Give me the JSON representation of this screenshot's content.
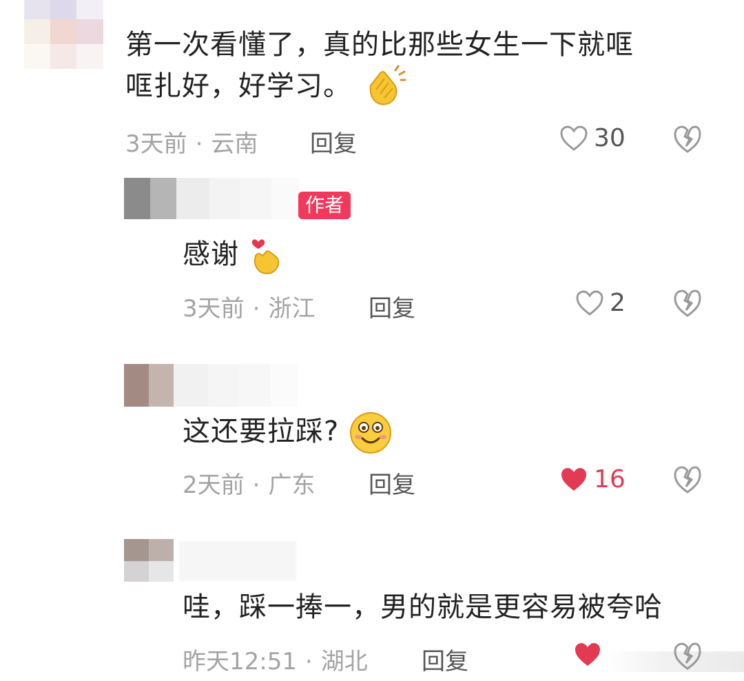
{
  "comments": [
    {
      "text_line1": "第一次看懂了，真的比那些女生一下就哐",
      "text_line2": "哐扎好，好学习。",
      "emoji": "clapping-hands",
      "time": "3天前",
      "location": "云南",
      "reply_label": "回复",
      "likes": "30",
      "liked": false
    },
    {
      "badge": "作者",
      "text": "感谢",
      "emoji": "finger-heart",
      "time": "3天前",
      "location": "浙江",
      "reply_label": "回复",
      "likes": "2",
      "liked": false
    },
    {
      "text": "这还要拉踩?",
      "emoji": "smiling-face",
      "time": "2天前",
      "location": "广东",
      "reply_label": "回复",
      "likes": "16",
      "liked": true
    },
    {
      "text": "哇，踩一捧一，男的就是更容易被夸哈",
      "time": "昨天12:51",
      "location": "湖北",
      "reply_label": "回复",
      "likes": "",
      "liked": true
    }
  ],
  "colors": {
    "accent": "#e33a53",
    "badge": "#f0395b",
    "meta": "#a3a3a3"
  }
}
